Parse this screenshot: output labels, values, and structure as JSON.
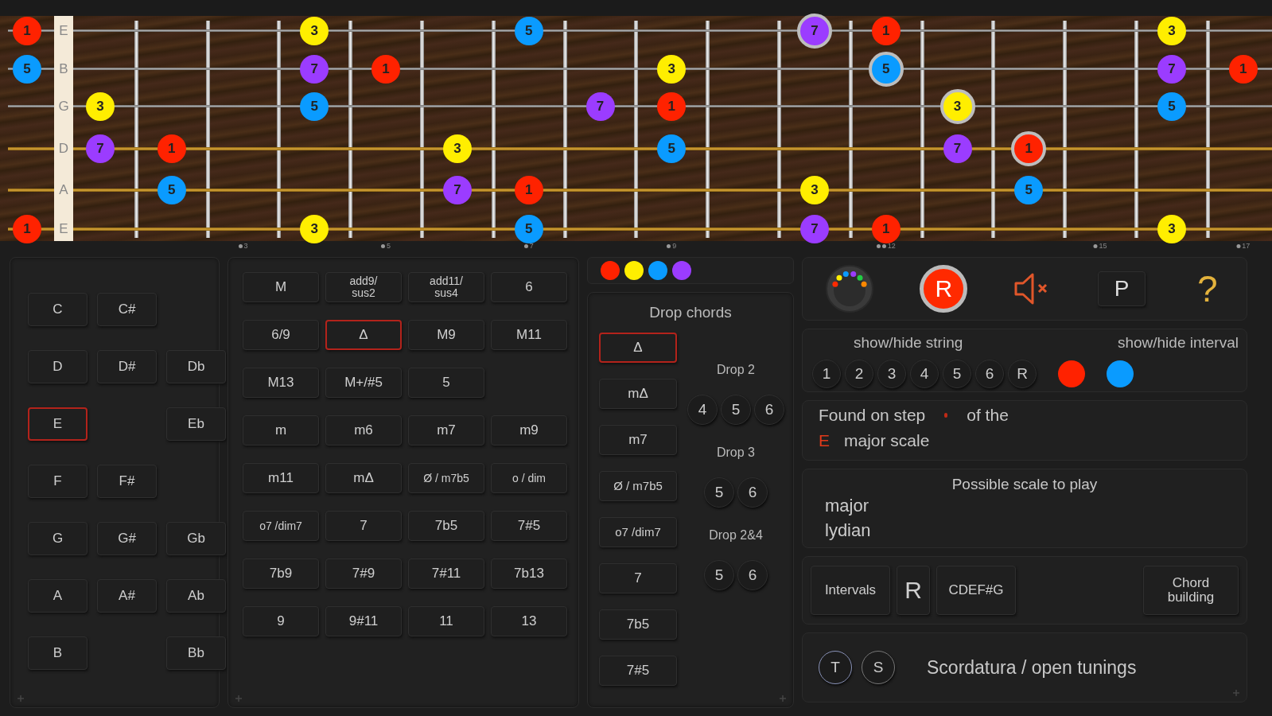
{
  "fretboard": {
    "strings": [
      {
        "name": "E",
        "wound": false,
        "slots": [
          {
            "kind": "note",
            "label": "1",
            "color": "#ff2200",
            "ringed": false
          },
          {
            "kind": "gap"
          },
          {
            "kind": "gap"
          },
          {
            "kind": "gap"
          },
          {
            "kind": "note",
            "label": "3",
            "color": "#ffee00",
            "ringed": false
          },
          {
            "kind": "gap"
          },
          {
            "kind": "gap"
          },
          {
            "kind": "note",
            "label": "5",
            "color": "#0a9bff",
            "ringed": false
          },
          {
            "kind": "gap"
          },
          {
            "kind": "gap"
          },
          {
            "kind": "gap"
          },
          {
            "kind": "note",
            "label": "7",
            "color": "#9b3cff",
            "ringed": true
          },
          {
            "kind": "note",
            "label": "1",
            "color": "#ff2200",
            "ringed": false
          },
          {
            "kind": "gap"
          },
          {
            "kind": "gap"
          },
          {
            "kind": "gap"
          },
          {
            "kind": "note",
            "label": "3",
            "color": "#ffee00",
            "ringed": false
          }
        ]
      },
      {
        "name": "B",
        "wound": false,
        "slots": [
          {
            "kind": "note",
            "label": "5",
            "color": "#0a9bff",
            "ringed": false
          },
          {
            "kind": "gap"
          },
          {
            "kind": "gap"
          },
          {
            "kind": "gap"
          },
          {
            "kind": "note",
            "label": "7",
            "color": "#9b3cff",
            "ringed": false
          },
          {
            "kind": "note",
            "label": "1",
            "color": "#ff2200",
            "ringed": false
          },
          {
            "kind": "gap"
          },
          {
            "kind": "gap"
          },
          {
            "kind": "gap"
          },
          {
            "kind": "note",
            "label": "3",
            "color": "#ffee00",
            "ringed": false
          },
          {
            "kind": "gap"
          },
          {
            "kind": "gap"
          },
          {
            "kind": "note",
            "label": "5",
            "color": "#0a9bff",
            "ringed": true
          },
          {
            "kind": "gap"
          },
          {
            "kind": "gap"
          },
          {
            "kind": "gap"
          },
          {
            "kind": "note",
            "label": "7",
            "color": "#9b3cff",
            "ringed": false
          },
          {
            "kind": "note",
            "label": "1",
            "color": "#ff2200",
            "ringed": false
          }
        ]
      },
      {
        "name": "G",
        "wound": false,
        "slots": [
          {
            "kind": "gap"
          },
          {
            "kind": "note",
            "label": "3",
            "color": "#ffee00",
            "ringed": false
          },
          {
            "kind": "gap"
          },
          {
            "kind": "gap"
          },
          {
            "kind": "note",
            "label": "5",
            "color": "#0a9bff",
            "ringed": false
          },
          {
            "kind": "gap"
          },
          {
            "kind": "gap"
          },
          {
            "kind": "gap"
          },
          {
            "kind": "note",
            "label": "7",
            "color": "#9b3cff",
            "ringed": false
          },
          {
            "kind": "note",
            "label": "1",
            "color": "#ff2200",
            "ringed": false
          },
          {
            "kind": "gap"
          },
          {
            "kind": "gap"
          },
          {
            "kind": "gap"
          },
          {
            "kind": "note",
            "label": "3",
            "color": "#ffee00",
            "ringed": true
          },
          {
            "kind": "gap"
          },
          {
            "kind": "gap"
          },
          {
            "kind": "note",
            "label": "5",
            "color": "#0a9bff",
            "ringed": false
          }
        ]
      },
      {
        "name": "D",
        "wound": true,
        "slots": [
          {
            "kind": "gap"
          },
          {
            "kind": "note",
            "label": "7",
            "color": "#9b3cff",
            "ringed": false
          },
          {
            "kind": "note",
            "label": "1",
            "color": "#ff2200",
            "ringed": false
          },
          {
            "kind": "gap"
          },
          {
            "kind": "gap"
          },
          {
            "kind": "gap"
          },
          {
            "kind": "note",
            "label": "3",
            "color": "#ffee00",
            "ringed": false
          },
          {
            "kind": "gap"
          },
          {
            "kind": "gap"
          },
          {
            "kind": "note",
            "label": "5",
            "color": "#0a9bff",
            "ringed": false
          },
          {
            "kind": "gap"
          },
          {
            "kind": "gap"
          },
          {
            "kind": "gap"
          },
          {
            "kind": "note",
            "label": "7",
            "color": "#9b3cff",
            "ringed": false
          },
          {
            "kind": "note",
            "label": "1",
            "color": "#ff2200",
            "ringed": true
          }
        ]
      },
      {
        "name": "A",
        "wound": true,
        "slots": [
          {
            "kind": "gap"
          },
          {
            "kind": "gap"
          },
          {
            "kind": "note",
            "label": "5",
            "color": "#0a9bff",
            "ringed": false
          },
          {
            "kind": "gap"
          },
          {
            "kind": "gap"
          },
          {
            "kind": "gap"
          },
          {
            "kind": "note",
            "label": "7",
            "color": "#9b3cff",
            "ringed": false
          },
          {
            "kind": "note",
            "label": "1",
            "color": "#ff2200",
            "ringed": false
          },
          {
            "kind": "gap"
          },
          {
            "kind": "gap"
          },
          {
            "kind": "gap"
          },
          {
            "kind": "note",
            "label": "3",
            "color": "#ffee00",
            "ringed": false
          },
          {
            "kind": "gap"
          },
          {
            "kind": "gap"
          },
          {
            "kind": "note",
            "label": "5",
            "color": "#0a9bff",
            "ringed": false
          }
        ]
      },
      {
        "name": "E",
        "wound": true,
        "slots": [
          {
            "kind": "note",
            "label": "1",
            "color": "#ff2200",
            "ringed": false
          },
          {
            "kind": "gap"
          },
          {
            "kind": "gap"
          },
          {
            "kind": "gap"
          },
          {
            "kind": "note",
            "label": "3",
            "color": "#ffee00",
            "ringed": false
          },
          {
            "kind": "gap"
          },
          {
            "kind": "gap"
          },
          {
            "kind": "note",
            "label": "5",
            "color": "#0a9bff",
            "ringed": false
          },
          {
            "kind": "gap"
          },
          {
            "kind": "gap"
          },
          {
            "kind": "gap"
          },
          {
            "kind": "note",
            "label": "7",
            "color": "#9b3cff",
            "ringed": false
          },
          {
            "kind": "note",
            "label": "1",
            "color": "#ff2200",
            "ringed": false
          },
          {
            "kind": "gap"
          },
          {
            "kind": "gap"
          },
          {
            "kind": "gap"
          },
          {
            "kind": "note",
            "label": "3",
            "color": "#ffee00",
            "ringed": false
          }
        ]
      }
    ],
    "fret_markers": [
      {
        "kind": "gap"
      },
      {
        "kind": "gap"
      },
      {
        "kind": "gap"
      },
      {
        "kind": "marker",
        "label": "3",
        "double": false
      },
      {
        "kind": "gap"
      },
      {
        "kind": "marker",
        "label": "5",
        "double": false
      },
      {
        "kind": "gap"
      },
      {
        "kind": "marker",
        "label": "7",
        "double": false
      },
      {
        "kind": "gap"
      },
      {
        "kind": "marker",
        "label": "9",
        "double": false
      },
      {
        "kind": "gap"
      },
      {
        "kind": "gap"
      },
      {
        "kind": "marker",
        "label": "12",
        "double": true
      },
      {
        "kind": "gap"
      },
      {
        "kind": "gap"
      },
      {
        "kind": "marker",
        "label": "15",
        "double": false
      },
      {
        "kind": "gap"
      },
      {
        "kind": "marker",
        "label": "17",
        "double": false
      }
    ]
  },
  "roots": [
    [
      {
        "kind": "button",
        "label": "C",
        "selected": false
      },
      {
        "kind": "button",
        "label": "C#",
        "selected": false
      }
    ],
    [
      {
        "kind": "button",
        "label": "D",
        "selected": false
      },
      {
        "kind": "button",
        "label": "D#",
        "selected": false
      },
      {
        "kind": "button",
        "label": "Db",
        "selected": false
      }
    ],
    [
      {
        "kind": "button",
        "label": "E",
        "selected": true
      },
      {
        "kind": "gap"
      },
      {
        "kind": "button",
        "label": "Eb",
        "selected": false
      }
    ],
    [
      {
        "kind": "button",
        "label": "F",
        "selected": false
      },
      {
        "kind": "button",
        "label": "F#",
        "selected": false
      }
    ],
    [
      {
        "kind": "button",
        "label": "G",
        "selected": false
      },
      {
        "kind": "button",
        "label": "G#",
        "selected": false
      },
      {
        "kind": "button",
        "label": "Gb",
        "selected": false
      }
    ],
    [
      {
        "kind": "button",
        "label": "A",
        "selected": false
      },
      {
        "kind": "button",
        "label": "A#",
        "selected": false
      },
      {
        "kind": "button",
        "label": "Ab",
        "selected": false
      }
    ],
    [
      {
        "kind": "button",
        "label": "B",
        "selected": false
      },
      {
        "kind": "gap"
      },
      {
        "kind": "button",
        "label": "Bb",
        "selected": false
      }
    ]
  ],
  "chord_types": [
    [
      {
        "label": "M",
        "selected": false
      },
      {
        "label": "add9/\nsus2",
        "selected": false
      },
      {
        "label": "add11/\nsus4",
        "selected": false
      },
      {
        "label": "6",
        "selected": false
      }
    ],
    [
      {
        "label": "6/9",
        "selected": false
      },
      {
        "label": "Δ",
        "selected": true
      },
      {
        "label": "M9",
        "selected": false
      },
      {
        "label": "M11",
        "selected": false
      }
    ],
    [
      {
        "label": "M13",
        "selected": false
      },
      {
        "label": "M+/#5",
        "selected": false
      },
      {
        "label": "5",
        "selected": false
      }
    ],
    [
      {
        "label": "m",
        "selected": false
      },
      {
        "label": "m6",
        "selected": false
      },
      {
        "label": "m7",
        "selected": false
      },
      {
        "label": "m9",
        "selected": false
      }
    ],
    [
      {
        "label": "m11",
        "selected": false
      },
      {
        "label": "mΔ",
        "selected": false
      },
      {
        "label": "Ø / m7b5",
        "selected": false
      },
      {
        "label": "o / dim",
        "selected": false
      }
    ],
    [
      {
        "label": "o7 /dim7",
        "selected": false
      },
      {
        "label": "7",
        "selected": false
      },
      {
        "label": "7b5",
        "selected": false
      },
      {
        "label": "7#5",
        "selected": false
      }
    ],
    [
      {
        "label": "7b9",
        "selected": false
      },
      {
        "label": "7#9",
        "selected": false
      },
      {
        "label": "7#11",
        "selected": false
      },
      {
        "label": "7b13",
        "selected": false
      }
    ],
    [
      {
        "label": "9",
        "selected": false
      },
      {
        "label": "9#11",
        "selected": false
      },
      {
        "label": "11",
        "selected": false
      },
      {
        "label": "13",
        "selected": false
      }
    ]
  ],
  "interval_legend": [
    {
      "color": "#ff2200"
    },
    {
      "color": "#ffee00"
    },
    {
      "color": "#0a9bff"
    },
    {
      "color": "#9b3cff"
    }
  ],
  "drop_chords": {
    "title": "Drop chords",
    "chords": [
      {
        "label": "Δ",
        "selected": true
      },
      {
        "label": "mΔ",
        "selected": false
      },
      {
        "label": "m7",
        "selected": false
      },
      {
        "label": "Ø / m7b5",
        "selected": false
      },
      {
        "label": "o7 /dim7",
        "selected": false
      },
      {
        "label": "7",
        "selected": false
      },
      {
        "label": "7b5",
        "selected": false
      },
      {
        "label": "7#5",
        "selected": false
      }
    ],
    "groups": [
      {
        "title": "Drop 2",
        "strings": [
          "4",
          "5",
          "6"
        ]
      },
      {
        "title": "Drop 3",
        "strings": [
          "5",
          "6"
        ]
      },
      {
        "title": "Drop 2&4",
        "strings": [
          "5",
          "6"
        ]
      }
    ]
  },
  "toolbar": {
    "record": "R",
    "mute": true,
    "p_button": "P",
    "help": "?"
  },
  "show_hide": {
    "string_title": "show/hide string",
    "interval_title": "show/hide interval",
    "strings": [
      "1",
      "2",
      "3",
      "4",
      "5",
      "6",
      "R"
    ],
    "intervals": [
      {
        "color": "#ff2200"
      },
      {
        "color": "#0a9bff"
      }
    ]
  },
  "found_on": {
    "prefix": "Found on step",
    "suffix": "of the",
    "root": "E",
    "scale": "major scale"
  },
  "possible_scales": {
    "title": "Possible scale to play",
    "items": [
      "major",
      "lydian"
    ]
  },
  "modes": [
    "Intervals",
    "R",
    "CDEF#G"
  ],
  "chord_building": "Chord\nbuilding",
  "tunings": {
    "buttons": [
      "T",
      "S"
    ],
    "label": "Scordatura / open tunings"
  }
}
